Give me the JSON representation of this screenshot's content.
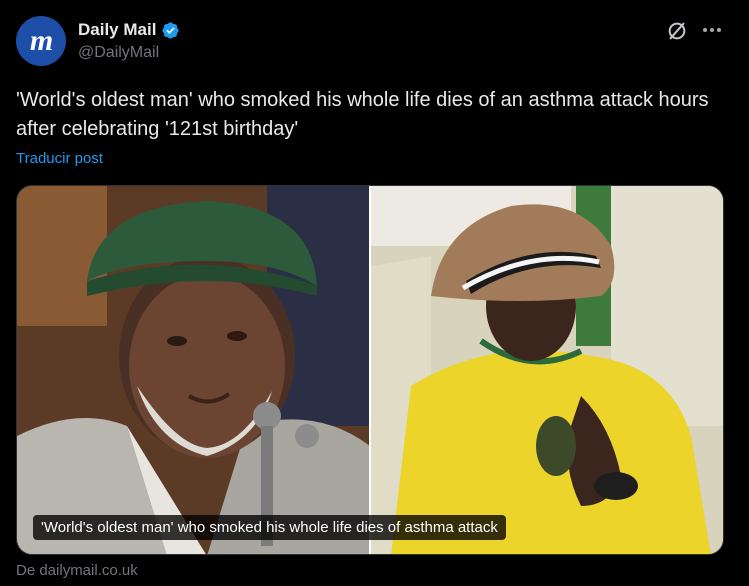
{
  "account": {
    "display_name": "Daily Mail",
    "handle": "@DailyMail",
    "avatar_letter": "m",
    "verified": true
  },
  "post": {
    "text": "'World's oldest man' who smoked his whole life dies of an asthma attack hours after celebrating '121st birthday'",
    "translate_label": "Traducir post"
  },
  "media": {
    "caption": "'World's oldest man' who smoked his whole life dies of asthma attack",
    "images": [
      {
        "description_icon": "photo-elderly-man-green-beanie"
      },
      {
        "description_icon": "photo-elderly-man-straw-hat-yellow-shirt"
      }
    ]
  },
  "card": {
    "source_label": "De dailymail.co.uk"
  },
  "colors": {
    "background": "#000000",
    "text": "#e7e9ea",
    "muted": "#71767b",
    "link": "#1d9bf0",
    "verified": "#1d9bf0",
    "avatar": "#1d4fa8"
  }
}
